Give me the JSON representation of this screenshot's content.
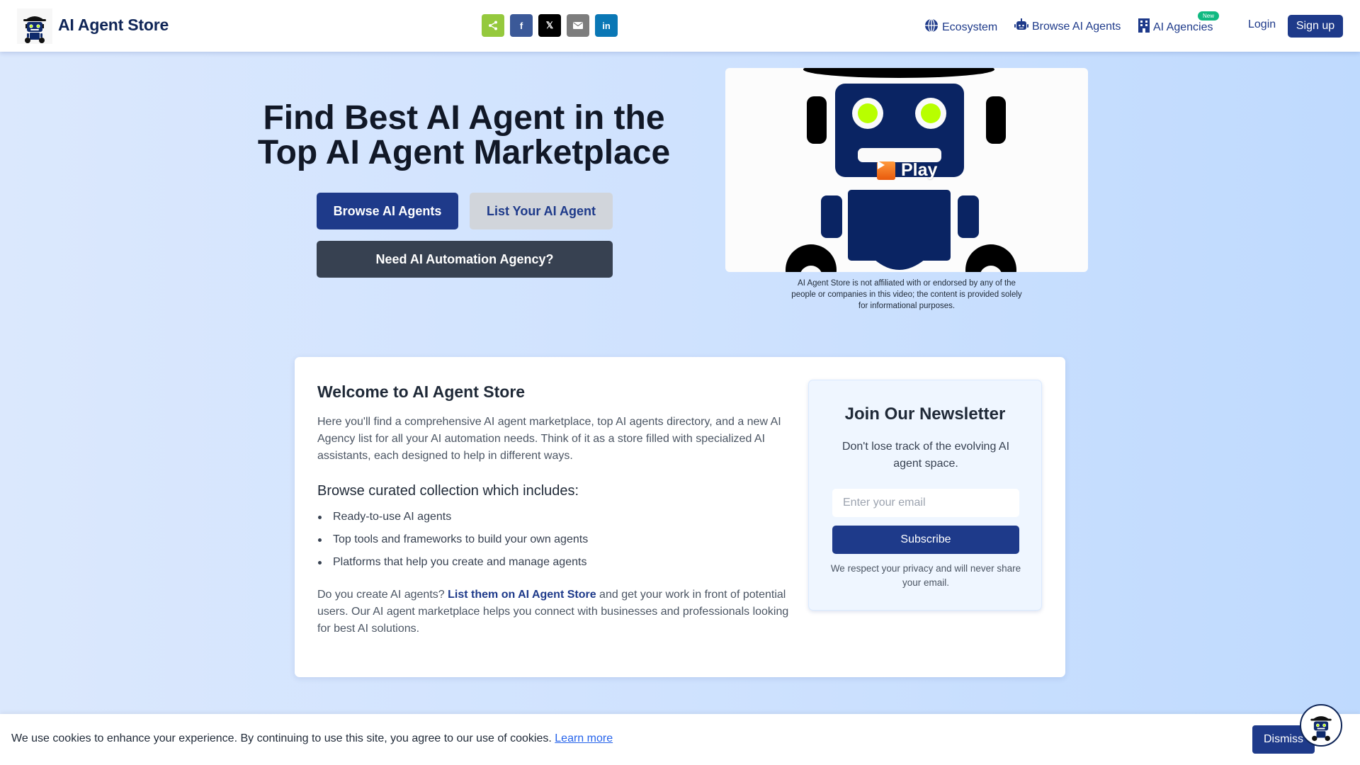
{
  "header": {
    "brand_title": "AI Agent Store",
    "logo_icon": "robot-logo-icon",
    "share_buttons": [
      {
        "name": "share",
        "icon": "share-icon",
        "label": "<",
        "color": "#95c93d"
      },
      {
        "name": "facebook",
        "icon": "facebook-icon",
        "label": "f",
        "color": "#3b5998"
      },
      {
        "name": "x",
        "icon": "x-icon",
        "label": "𝕏",
        "color": "#000000"
      },
      {
        "name": "email",
        "icon": "email-icon",
        "label": "✉",
        "color": "#7d7d7d"
      },
      {
        "name": "linkedin",
        "icon": "linkedin-icon",
        "label": "in",
        "color": "#0a77b5"
      }
    ],
    "nav": [
      {
        "label": "Ecosystem",
        "icon": "globe-icon"
      },
      {
        "label": "Browse AI Agents",
        "icon": "robot-icon"
      },
      {
        "label": "AI Agencies",
        "icon": "building-icon",
        "badge": "New"
      }
    ],
    "login_label": "Login",
    "signup_label": "Sign up"
  },
  "hero": {
    "title_line1": "Find Best AI Agent in the",
    "title_line2": "Top AI Agent Marketplace",
    "browse_button": "Browse AI Agents",
    "list_button": "List Your AI Agent",
    "agency_button": "Need AI Automation Agency?",
    "video": {
      "play_label": "Play",
      "play_icon": "play-icon"
    },
    "disclaimer": "AI Agent Store is not affiliated with or endorsed by any of the people or companies in this video; the content is provided solely for informational purposes."
  },
  "welcome": {
    "title": "Welcome to AI Agent Store",
    "intro": "Here you'll find a comprehensive AI agent marketplace, top AI agents directory, and a new AI Agency list for all your AI automation needs. Think of it as a store filled with specialized AI assistants, each designed to help in different ways.",
    "subtitle": "Browse curated collection which includes:",
    "items": [
      "Ready-to-use AI agents",
      "Top tools and frameworks to build your own agents",
      "Platforms that help you create and manage agents"
    ],
    "cta_prefix": "Do you create AI agents? ",
    "cta_link": "List them on AI Agent Store",
    "cta_suffix": " and get your work in front of potential users. Our AI agent marketplace helps you connect with businesses and professionals looking for best AI solutions."
  },
  "newsletter": {
    "title": "Join Our Newsletter",
    "description": "Don't lose track of the evolving AI agent space.",
    "email_placeholder": "Enter your email",
    "email_value": "",
    "subscribe_label": "Subscribe",
    "privacy_note": "We respect your privacy and will never share your email."
  },
  "cookie": {
    "text": "We use cookies to enhance your experience. By continuing to use this site, you agree to our use of cookies. ",
    "learn_more": "Learn more",
    "dismiss_label": "Dismiss"
  },
  "colors": {
    "brand": "#1e3a8a",
    "brand_dark": "#0f2557",
    "agency_button": "#374151",
    "secondary_button": "#d1d5db",
    "badge": "#10b981",
    "link": "#2563eb",
    "robot_eye": "#b8ff00"
  }
}
